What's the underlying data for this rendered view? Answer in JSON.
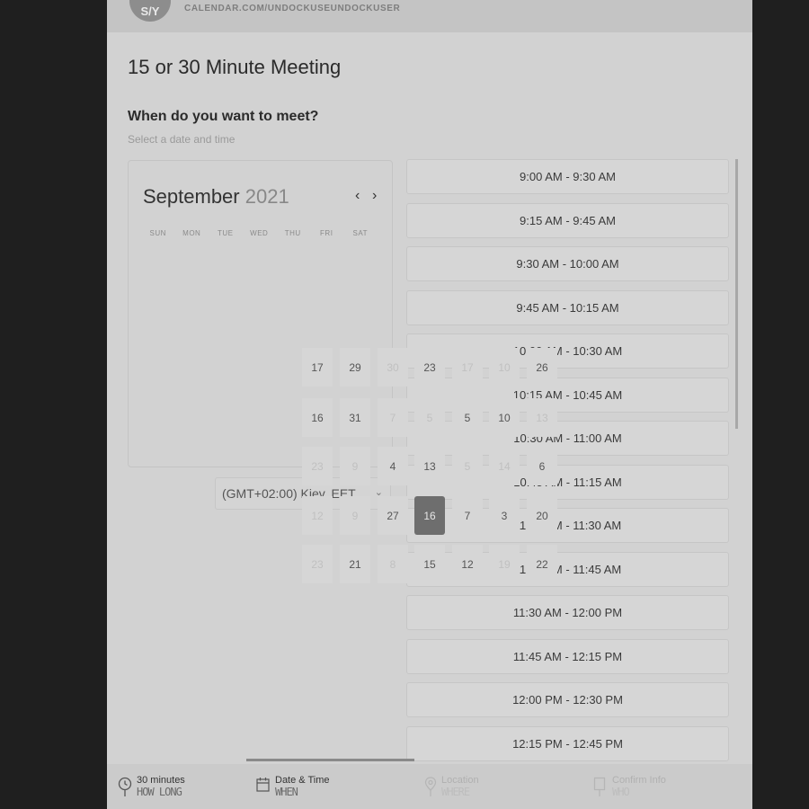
{
  "header": {
    "avatar_initials": "S/Y",
    "url": "CALENDAR.COM/UNDOCKUSEUNDOCKUSER"
  },
  "page": {
    "title": "15 or 30 Minute Meeting",
    "question": "When do you want to meet?",
    "subtitle": "Select a date and time"
  },
  "calendar": {
    "month": "September",
    "year": "2021",
    "prev": "‹",
    "next": "›",
    "weekdays": [
      "SUN",
      "MON",
      "TUE",
      "WED",
      "THU",
      "FRI",
      "SAT"
    ],
    "visible_days": [
      {
        "row": 0,
        "values": [
          "17",
          "29",
          "30",
          "23",
          "17",
          "10",
          "26"
        ],
        "muted": [
          false,
          false,
          true,
          false,
          true,
          true,
          false
        ]
      },
      {
        "row": 1,
        "values": [
          "16",
          "31",
          "7",
          "5",
          "5",
          "10",
          "13"
        ],
        "muted": [
          false,
          false,
          true,
          true,
          false,
          false,
          true
        ]
      },
      {
        "row": 2,
        "values": [
          "23",
          "9",
          "4",
          "13",
          "5",
          "14",
          "6"
        ],
        "muted": [
          true,
          true,
          false,
          false,
          true,
          true,
          false
        ]
      },
      {
        "row": 3,
        "values": [
          "12",
          "9",
          "27",
          "16",
          "7",
          "3",
          "20"
        ],
        "muted": [
          true,
          true,
          false,
          false,
          false,
          false,
          false
        ]
      },
      {
        "row": 4,
        "values": [
          "23",
          "21",
          "8",
          "15",
          "12",
          "19",
          "22"
        ],
        "muted": [
          true,
          false,
          true,
          false,
          false,
          true,
          false
        ]
      }
    ],
    "selected_day": "16"
  },
  "timezone": {
    "value": "(GMT+02:00) Kiev, EET",
    "chevron": "⌄"
  },
  "time_slots": [
    "9:00 AM - 9:30 AM",
    "9:15 AM - 9:45 AM",
    "9:30 AM - 10:00 AM",
    "9:45 AM - 10:15 AM",
    "10:00 AM - 10:30 AM",
    "10:15 AM - 10:45 AM",
    "10:30 AM - 11:00 AM",
    "10:45 AM - 11:15 AM",
    "11:00 AM - 11:30 AM",
    "11:15 AM - 11:45 AM",
    "11:30 AM - 12:00 PM",
    "11:45 AM - 12:15 PM",
    "12:00 PM - 12:30 PM",
    "12:15 PM - 12:45 PM"
  ],
  "steps": [
    {
      "label": "30 minutes",
      "sub": "HOW LONG",
      "icon": "clock-icon",
      "active": true
    },
    {
      "label": "Date & Time",
      "sub": "WHEN",
      "icon": "calendar-icon",
      "active": true
    },
    {
      "label": "Location",
      "sub": "WHERE",
      "icon": "map-pin-icon",
      "active": false
    },
    {
      "label": "Confirm Info",
      "sub": "WHO",
      "icon": "form-icon",
      "active": false
    }
  ],
  "colors": {
    "background": "#1f1f1f",
    "panel": "#d2d2d2",
    "selected_day": "#6e6e6e"
  }
}
